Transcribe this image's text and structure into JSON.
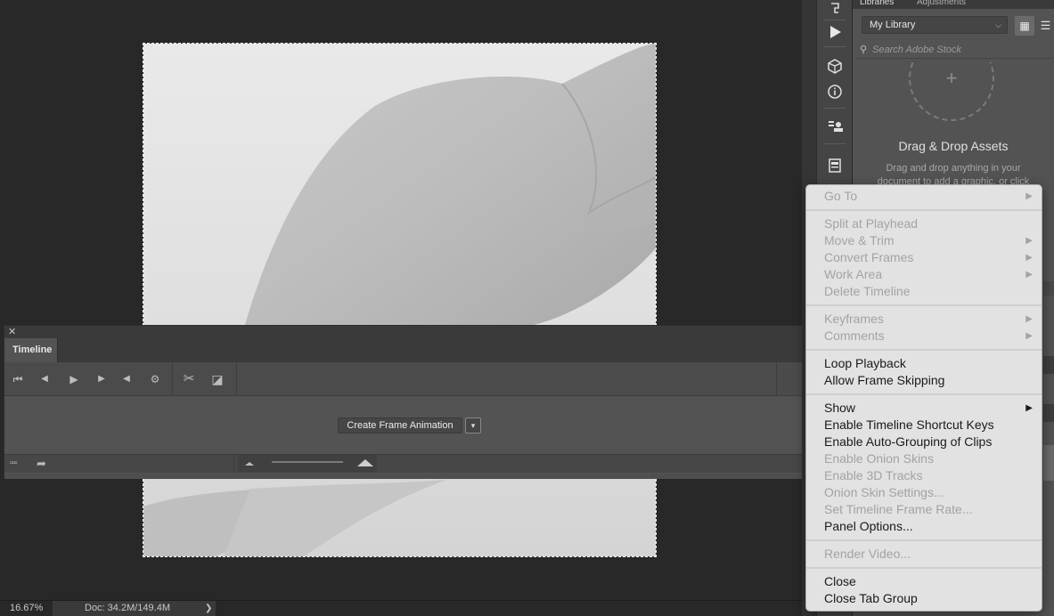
{
  "status_bar": {
    "zoom": "16.67%",
    "doc_info": "Doc: 34.2M/149.4M",
    "arrow": "❯"
  },
  "timeline": {
    "close_glyph": "✕",
    "tab_label": "Timeline",
    "create_button_label": "Create Frame Animation",
    "dropdown_glyph": "▾",
    "tools": {
      "first_frame": "⏮",
      "prev_frame": "◀",
      "play": "▶",
      "next_frame": "▶",
      "audio": "◀",
      "settings": "⚙",
      "split": "✂",
      "transition": "◪"
    },
    "bottom": {
      "frames_icon": "▫▫▫",
      "share_icon": "➦"
    }
  },
  "right_toolbar": {
    "icons": [
      "history-icon",
      "play-actions-icon",
      "3d-icon",
      "info-icon",
      "layer-comps-icon",
      "properties-icon"
    ]
  },
  "libraries": {
    "tab_libraries": "Libraries",
    "tab_adjustments": "Adjustments",
    "library_name": "My Library",
    "search_placeholder": "Search Adobe Stock",
    "drop_title": "Drag & Drop Assets",
    "drop_desc_line1": "Drag and drop anything in your",
    "drop_desc_line2": "document to add a graphic, or click"
  },
  "context_menu": {
    "groups": [
      [
        {
          "label": "Go To",
          "enabled": false,
          "submenu": true
        }
      ],
      [
        {
          "label": "Split at Playhead",
          "enabled": false,
          "submenu": false
        },
        {
          "label": "Move & Trim",
          "enabled": false,
          "submenu": true
        },
        {
          "label": "Convert Frames",
          "enabled": false,
          "submenu": true
        },
        {
          "label": "Work Area",
          "enabled": false,
          "submenu": true
        },
        {
          "label": "Delete Timeline",
          "enabled": false,
          "submenu": false
        }
      ],
      [
        {
          "label": "Keyframes",
          "enabled": false,
          "submenu": true
        },
        {
          "label": "Comments",
          "enabled": false,
          "submenu": true
        }
      ],
      [
        {
          "label": "Loop Playback",
          "enabled": true,
          "submenu": false
        },
        {
          "label": "Allow Frame Skipping",
          "enabled": true,
          "submenu": false
        }
      ],
      [
        {
          "label": "Show",
          "enabled": true,
          "submenu": true
        },
        {
          "label": "Enable Timeline Shortcut Keys",
          "enabled": true,
          "submenu": false
        },
        {
          "label": "Enable Auto-Grouping of Clips",
          "enabled": true,
          "submenu": false
        },
        {
          "label": "Enable Onion Skins",
          "enabled": false,
          "submenu": false
        },
        {
          "label": "Enable 3D Tracks",
          "enabled": false,
          "submenu": false
        },
        {
          "label": "Onion Skin Settings...",
          "enabled": false,
          "submenu": false
        },
        {
          "label": "Set Timeline Frame Rate...",
          "enabled": false,
          "submenu": false
        },
        {
          "label": "Panel Options...",
          "enabled": true,
          "submenu": false
        }
      ],
      [
        {
          "label": "Render Video...",
          "enabled": false,
          "submenu": false
        }
      ],
      [
        {
          "label": "Close",
          "enabled": true,
          "submenu": false
        },
        {
          "label": "Close Tab Group",
          "enabled": true,
          "submenu": false
        }
      ]
    ],
    "submenu_glyph": "▶"
  }
}
